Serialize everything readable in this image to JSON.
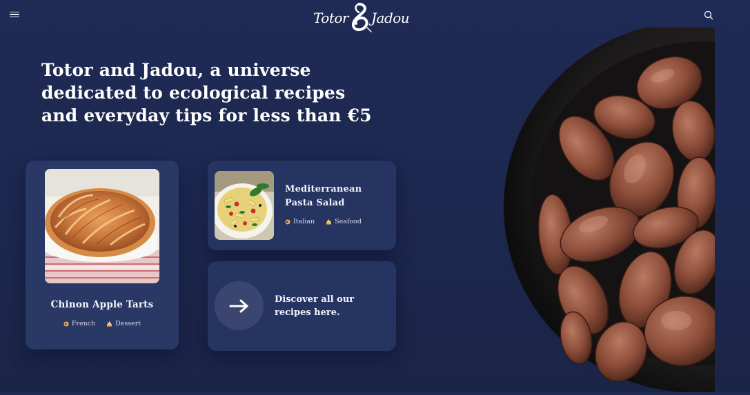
{
  "header": {
    "logo_word_left": "Totor",
    "logo_word_right": "Jadou",
    "menu_icon": "hamburger-menu-icon",
    "search_icon": "search-icon"
  },
  "hero": {
    "title": "Totor and Jadou, a universe dedicated to ecological recipes and everyday tips for less than €5"
  },
  "cards": {
    "tart": {
      "title": "Chinon Apple Tarts",
      "cuisine": "French",
      "category": "Dessert"
    },
    "pasta": {
      "title": "Mediterranean Pasta Salad",
      "cuisine": "Italian",
      "category": "Seafood"
    },
    "discover": {
      "label": "Discover all our recipes here."
    }
  },
  "colors": {
    "background": "#1e2a52",
    "card": "#263462",
    "text": "#ffffff",
    "tag_icon": "#f0b35a"
  }
}
